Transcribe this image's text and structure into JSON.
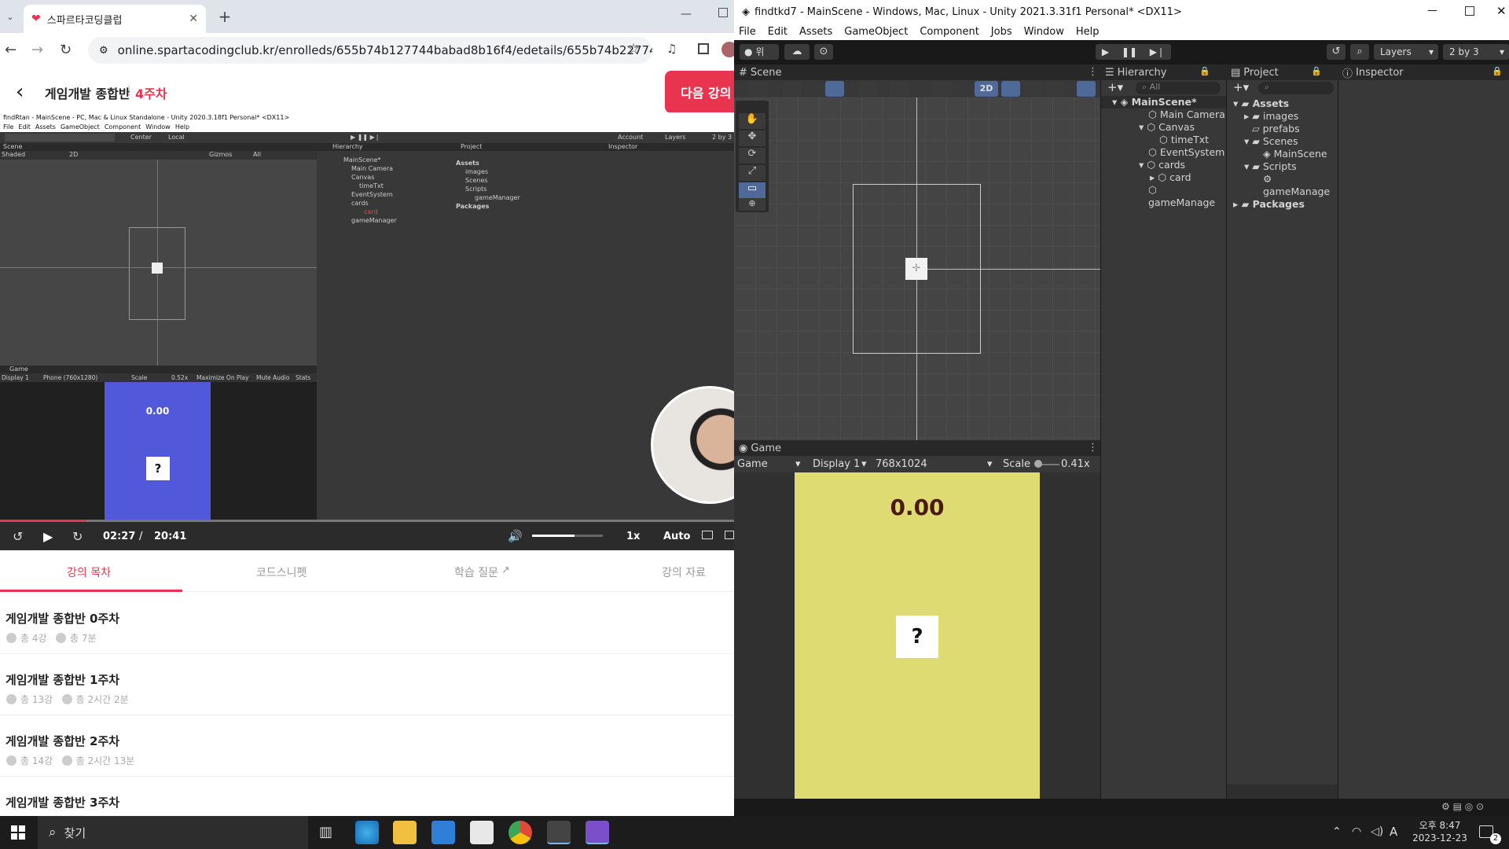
{
  "browser": {
    "tab_title": "스파르타코딩클럽",
    "url": "online.spartacodingclub.kr/enrolleds/655b74b127744babad8b16f4/edetails/655b74b227744babad8b...",
    "course_title": "게임개발 종합반",
    "week": "4주차",
    "next_button": "다음 강의",
    "video": {
      "unity_title": "findRtan - MainScene - PC, Mac & Linux Standalone - Unity 2020.3.18f1 Personal* <DX11>",
      "menu": [
        "File",
        "Edit",
        "Assets",
        "GameObject",
        "Component",
        "Window",
        "Help"
      ],
      "toolbar": {
        "center": "Center",
        "local": "Local",
        "account": "Account",
        "layers": "Layers",
        "layout": "2 by 3"
      },
      "scene_tab": "Scene",
      "shaded": "Shaded",
      "twod": "2D",
      "gizmos": "Gizmos",
      "search": "All",
      "hierarchy_tab": "Hierarchy",
      "project_tab": "Project",
      "inspector_tab": "Inspector",
      "hierarchy": [
        "MainScene*",
        "Main Camera",
        "Canvas",
        "timeTxt",
        "EventSystem",
        "cards",
        "card",
        "gameManager"
      ],
      "project": [
        "Assets",
        "images",
        "Scenes",
        "Scripts",
        "gameManager",
        "Packages"
      ],
      "game_tab": "Game",
      "display": "Display 1",
      "resolution": "Phone (760x1280)",
      "scale_label": "Scale",
      "scale": "0.52x",
      "game_opts": [
        "Maximize On Play",
        "Mute Audio",
        "Stats"
      ],
      "timer": "0.00",
      "card": "?",
      "time_current": "02:27",
      "time_sep": "/",
      "time_total": "20:41",
      "progress": 0.118,
      "volume": 0.6,
      "speed": "1x",
      "quality": "Auto"
    },
    "tabs": [
      "강의 목차",
      "코드스니펫",
      "학습 질문",
      "강의 자료"
    ],
    "lessons": [
      {
        "title": "게임개발 종합반 0주차",
        "count": "총 4강",
        "time": "총 7분"
      },
      {
        "title": "게임개발 종합반 1주차",
        "count": "총 13강",
        "time": "총 2시간 2분"
      },
      {
        "title": "게임개발 종합반 2주차",
        "count": "총 14강",
        "time": "총 2시간 13분"
      },
      {
        "title": "게임개발 종합반 3주차",
        "count": "",
        "time": ""
      }
    ]
  },
  "unity": {
    "title": "findtkd7 - MainScene - Windows, Mac, Linux - Unity 2021.3.31f1 Personal* <DX11>",
    "menu": [
      "File",
      "Edit",
      "Assets",
      "GameObject",
      "Component",
      "Jobs",
      "Window",
      "Help"
    ],
    "account_label": "위",
    "layers": "Layers",
    "layout": "2 by 3",
    "scene_tab": "Scene",
    "twod": "2D",
    "hierarchy_tab": "Hierarchy",
    "project_tab": "Project",
    "inspector_tab": "Inspector",
    "search": "All",
    "hierarchy": [
      "MainScene*",
      "Main Camera",
      "Canvas",
      "timeTxt",
      "EventSystem",
      "cards",
      "card",
      "gameManage"
    ],
    "project": [
      "Assets",
      "images",
      "prefabs",
      "Scenes",
      "MainScene",
      "Scripts",
      "gameManage",
      "Packages"
    ],
    "game_tab": "Game",
    "game_mode": "Game",
    "display": "Display 1",
    "resolution": "768x1024",
    "scale_label": "Scale",
    "scale": "0.41x",
    "timer": "0.00",
    "card": "?",
    "colors": {
      "game_bg": "#dedb72",
      "timer": "#4a1a10"
    }
  },
  "taskbar": {
    "search": "찾기",
    "ime": "A",
    "time": "오후 8:47",
    "date": "2023-12-23",
    "notifications": "2"
  }
}
